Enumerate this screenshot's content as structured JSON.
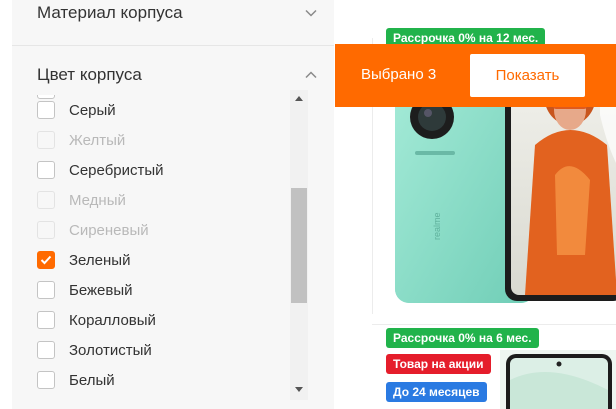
{
  "filters": {
    "sections": [
      {
        "title": "Материал корпуса",
        "expanded": false
      },
      {
        "title": "Цвет корпуса",
        "expanded": true
      }
    ],
    "color_options": [
      {
        "label": "Серый",
        "state": "enabled",
        "checked": false
      },
      {
        "label": "Желтый",
        "state": "disabled",
        "checked": false
      },
      {
        "label": "Серебристый",
        "state": "enabled",
        "checked": false
      },
      {
        "label": "Медный",
        "state": "disabled",
        "checked": false
      },
      {
        "label": "Сиреневый",
        "state": "disabled",
        "checked": false
      },
      {
        "label": "Зеленый",
        "state": "enabled",
        "checked": true
      },
      {
        "label": "Бежевый",
        "state": "enabled",
        "checked": false
      },
      {
        "label": "Коралловый",
        "state": "enabled",
        "checked": false
      },
      {
        "label": "Золотистый",
        "state": "enabled",
        "checked": false
      },
      {
        "label": "Белый",
        "state": "enabled",
        "checked": false
      }
    ]
  },
  "selection_bar": {
    "selected_text": "Выбрано 3",
    "show_button_label": "Показать"
  },
  "products": [
    {
      "badges": [
        {
          "text": "Рассрочка 0% на 12 мес.",
          "color": "green"
        }
      ],
      "image": "realme-phone-teal-with-woman-orange-jacket"
    },
    {
      "badges": [
        {
          "text": "Рассрочка 0% на 6 мес.",
          "color": "green"
        },
        {
          "text": "Товар на акции",
          "color": "red"
        },
        {
          "text": "До 24 месяцев",
          "color": "blue"
        }
      ],
      "image": "phone-partial"
    }
  ],
  "colors": {
    "accent": "#ff6a00",
    "badge_green": "#21b34b",
    "badge_red": "#e51d2b",
    "badge_blue": "#2a7ae2"
  }
}
